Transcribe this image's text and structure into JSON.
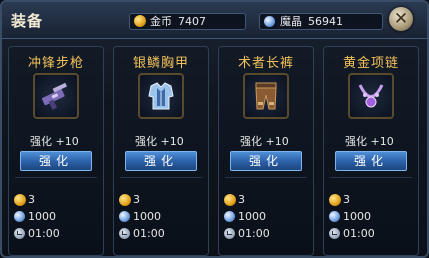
{
  "header": {
    "title": "装备"
  },
  "currency": {
    "gold_label": "金币",
    "gold_value": "7407",
    "crystal_label": "魔晶",
    "crystal_value": "56941"
  },
  "close_label": "✕",
  "cards": [
    {
      "name": "冲锋步枪",
      "icon": "rifle-icon",
      "level": "强化 +10",
      "button": "强化",
      "cost_coin": "3",
      "cost_crystal": "1000",
      "time": "01:00"
    },
    {
      "name": "银鳞胸甲",
      "icon": "chest-armor-icon",
      "level": "强化 +10",
      "button": "强化",
      "cost_coin": "3",
      "cost_crystal": "1000",
      "time": "01:00"
    },
    {
      "name": "术者长裤",
      "icon": "pants-icon",
      "level": "强化 +10",
      "button": "强化",
      "cost_coin": "3",
      "cost_crystal": "1000",
      "time": "01:00"
    },
    {
      "name": "黄金项链",
      "icon": "necklace-icon",
      "level": "强化 +10",
      "button": "强化",
      "cost_coin": "3",
      "cost_crystal": "1000",
      "time": "01:00"
    }
  ],
  "colors": {
    "accent": "#f3c25a",
    "button": "#3f7ccc"
  }
}
